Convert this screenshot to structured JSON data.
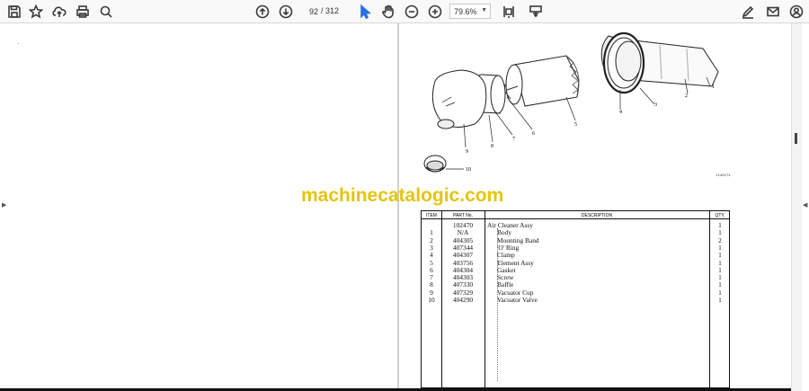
{
  "toolbar": {
    "page_current": "92",
    "page_separator": "/",
    "page_total": "312",
    "zoom": "79.6%",
    "icons": {
      "save": "save-icon",
      "bookmark": "star-icon",
      "upload": "cloud-upload-icon",
      "print": "print-icon",
      "find": "search-icon",
      "prev_page": "arrow-up-circle-icon",
      "next_page": "arrow-down-circle-icon",
      "select": "cursor-arrow-icon",
      "hand": "hand-icon",
      "zoom_out": "zoom-out-icon",
      "zoom_in": "zoom-in-icon",
      "fit": "fit-page-icon",
      "annotate": "annotate-icon",
      "sign": "sign-icon",
      "email": "email-icon",
      "account": "account-icon"
    }
  },
  "watermark": "machinecatalogic.com",
  "figure": {
    "callouts": [
      "1",
      "2",
      "3",
      "4",
      "5",
      "6",
      "7",
      "8",
      "9",
      "10"
    ],
    "ref_code": "Y146171"
  },
  "parts_table": {
    "headers": {
      "item": "ITEM",
      "part_no": "PART No.",
      "description": "DESCRIPTION",
      "qty": "QTY."
    },
    "rows": [
      {
        "item": "",
        "part_no": "102470",
        "description": "Air Cleaner Assy",
        "qty": "1",
        "indent": 0
      },
      {
        "item": "1",
        "part_no": "N/A",
        "description": "Body",
        "qty": "1",
        "indent": 1
      },
      {
        "item": "2",
        "part_no": "404305",
        "description": "Mounting Band",
        "qty": "2",
        "indent": 1
      },
      {
        "item": "3",
        "part_no": "407344",
        "description": "'O' Ring",
        "qty": "1",
        "indent": 1
      },
      {
        "item": "4",
        "part_no": "404307",
        "description": "Clamp",
        "qty": "1",
        "indent": 1
      },
      {
        "item": "5",
        "part_no": "403756",
        "description": "Element Assy",
        "qty": "1",
        "indent": 1
      },
      {
        "item": "6",
        "part_no": "404304",
        "description": "Gasket",
        "qty": "1",
        "indent": 1
      },
      {
        "item": "7",
        "part_no": "404303",
        "description": "Screw",
        "qty": "1",
        "indent": 1
      },
      {
        "item": "8",
        "part_no": "407330",
        "description": "Baffle",
        "qty": "1",
        "indent": 1
      },
      {
        "item": "9",
        "part_no": "407329",
        "description": "Vacuator Cup",
        "qty": "1",
        "indent": 1
      },
      {
        "item": "10",
        "part_no": "404290",
        "description": "Vacuator Valve",
        "qty": "1",
        "indent": 1
      }
    ]
  },
  "colors": {
    "watermark": "#e5c411",
    "toolbar_bg": "#f9f9fa",
    "page_gap": "#cfcfcf"
  }
}
